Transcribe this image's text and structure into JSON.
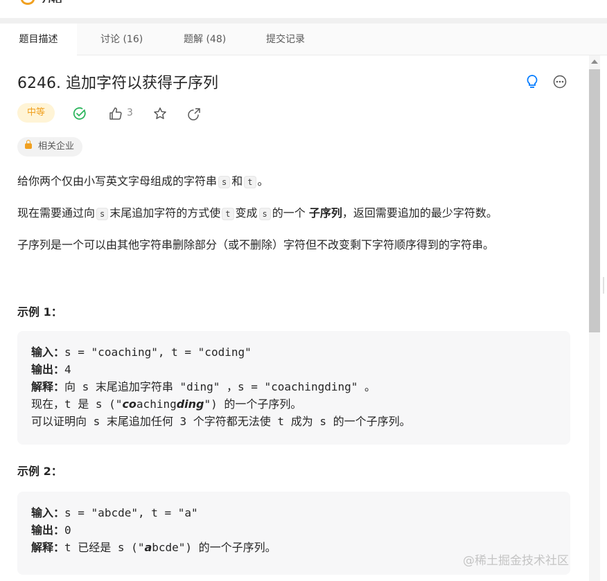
{
  "header": {
    "logo_text": "力扣"
  },
  "tabs": [
    {
      "label": "题目描述",
      "active": true
    },
    {
      "label": "讨论 (16)",
      "active": false
    },
    {
      "label": "题解 (48)",
      "active": false
    },
    {
      "label": "提交记录",
      "active": false
    }
  ],
  "problem": {
    "title": "6246. 追加字符以获得子序列",
    "difficulty": "中等",
    "likes": "3",
    "company_tag": "相关企业",
    "paragraphs": {
      "p1": {
        "a": "给你两个仅由小写英文字母组成的字符串",
        "s": "s",
        "b": "和",
        "t": "t",
        "c": "。"
      },
      "p2": {
        "a": "现在需要通过向",
        "s": "s",
        "b": "末尾追加字符的方式使",
        "t": "t",
        "c": "变成",
        "s2": "s",
        "d": "的一个",
        "em": "子序列",
        "e": "，返回需要追加的最少字符数。"
      },
      "p3": "子序列是一个可以由其他字符串删除部分（或不删除）字符但不改变剩下字符顺序得到的字符串。"
    },
    "examples": [
      {
        "title": "示例 1：",
        "input_label": "输入：",
        "input": "s = \"coaching\", t = \"coding\"",
        "output_label": "输出：",
        "output": "4",
        "explain_label": "解释：",
        "explain": "向 s 末尾追加字符串 \"ding\" ，s = \"coachingding\" 。",
        "line4_a": "现在，t 是 s (\"",
        "line4_b1": "co",
        "line4_c": "aching",
        "line4_b2": "ding",
        "line4_d": "\") 的一个子序列。",
        "line5": "可以证明向 s 末尾追加任何 3 个字符都无法使 t 成为 s 的一个子序列。"
      },
      {
        "title": "示例 2：",
        "input_label": "输入：",
        "input": "s = \"abcde\", t = \"a\"",
        "output_label": "输出：",
        "output": "0",
        "explain_label": "解释：",
        "explain_a": "t 已经是 s (\"",
        "explain_b": "a",
        "explain_c": "bcde\") 的一个子序列。"
      }
    ]
  },
  "watermark": "@稀土掘金技术社区",
  "colors": {
    "accent_orange": "#f0a020",
    "accepted_green": "#2db55d",
    "hint_blue": "#007aff"
  }
}
